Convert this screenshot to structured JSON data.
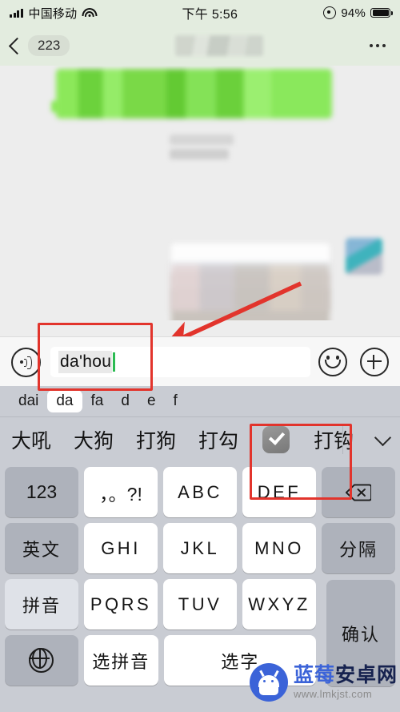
{
  "statusbar": {
    "carrier": "中国移动",
    "time": "下午 5:56",
    "battery": "94%",
    "signal_icon": "signal-bars-icon",
    "wifi_icon": "wifi-icon",
    "alarm_icon": "alarm-clock-icon",
    "battery_icon": "battery-icon"
  },
  "navbar": {
    "back_icon": "chevron-left-icon",
    "unread_count": "223",
    "title": "",
    "more_icon": "more-dots-icon"
  },
  "chat": {
    "messages": [
      {
        "type": "bubble",
        "side": "incoming",
        "color": "#7ad947",
        "content": ""
      },
      {
        "type": "text",
        "side": "incoming",
        "content": ""
      },
      {
        "type": "image",
        "side": "outgoing",
        "content": ""
      }
    ]
  },
  "inputbar": {
    "voice_icon": "voice-input-icon",
    "composing_text": "da'hou",
    "placeholder": "",
    "caret_color": "#2bbb52",
    "emoji_icon": "emoji-smiley-icon",
    "plus_icon": "plus-circle-icon"
  },
  "ime": {
    "pinyin_segments": [
      {
        "label": "dai",
        "selected": false
      },
      {
        "label": "da",
        "selected": true
      },
      {
        "label": "fa",
        "selected": false
      },
      {
        "label": "d",
        "selected": false
      },
      {
        "label": "e",
        "selected": false
      },
      {
        "label": "f",
        "selected": false
      }
    ],
    "candidates": [
      {
        "label": "大吼",
        "type": "text"
      },
      {
        "label": "大狗",
        "type": "text"
      },
      {
        "label": "打狗",
        "type": "text"
      },
      {
        "label": "打勾",
        "type": "text"
      },
      {
        "label": "✅",
        "type": "emoji",
        "name": "white-heavy-check-mark-emoji"
      },
      {
        "label": "打钩",
        "type": "text",
        "clipped": true
      }
    ],
    "expand_icon": "chevron-down-icon",
    "keys": [
      [
        {
          "label": "123",
          "style": "fn"
        },
        {
          "label": "，。?!",
          "style": "white"
        },
        {
          "label": "ABC",
          "style": "white"
        },
        {
          "label": "DEF",
          "style": "white"
        },
        {
          "label": "",
          "style": "fn",
          "icon": "backspace-icon"
        }
      ],
      [
        {
          "label": "英文",
          "style": "fn"
        },
        {
          "label": "GHI",
          "style": "white"
        },
        {
          "label": "JKL",
          "style": "white"
        },
        {
          "label": "MNO",
          "style": "white"
        },
        {
          "label": "分隔",
          "style": "fn"
        }
      ],
      [
        {
          "label": "拼音",
          "style": "fn-light"
        },
        {
          "label": "PQRS",
          "style": "white"
        },
        {
          "label": "TUV",
          "style": "white"
        },
        {
          "label": "WXYZ",
          "style": "white"
        }
      ],
      [
        {
          "label": "",
          "style": "fn",
          "icon": "globe-icon"
        },
        {
          "label": "选拼音",
          "style": "white"
        },
        {
          "label": "选字",
          "style": "white"
        }
      ]
    ],
    "confirm_key": "确认"
  },
  "annotations": {
    "box_input_color": "#e2342c",
    "box_candidate_color": "#e2342c",
    "arrow_color": "#e2342c"
  },
  "watermark": {
    "title_part1": "蓝莓",
    "title_part2": "安卓网",
    "url": "www.lmkjst.com",
    "logo_icon": "android-robot-logo"
  }
}
